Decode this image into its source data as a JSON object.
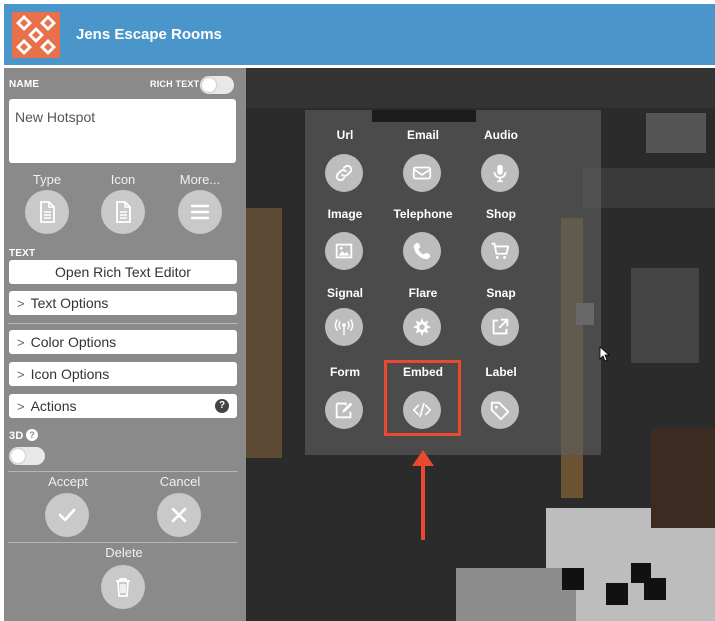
{
  "app": {
    "title": "Jens Escape Rooms"
  },
  "sidebar": {
    "name_label": "NAME",
    "rich_text_label": "RICH TEXT",
    "name_value": "New Hotspot",
    "type_label": "Type",
    "icon_label": "Icon",
    "more_label": "More...",
    "text_label": "TEXT",
    "rich_editor_button": "Open Rich Text Editor",
    "text_options": "Text Options",
    "color_options": "Color Options",
    "icon_options": "Icon Options",
    "actions": "Actions",
    "actions_help": "?",
    "threed_label": "3D",
    "threed_help": "?",
    "accept_label": "Accept",
    "cancel_label": "Cancel",
    "delete_label": "Delete"
  },
  "icon_picker": {
    "items": [
      {
        "label": "Url",
        "icon": "link-icon"
      },
      {
        "label": "Email",
        "icon": "envelope-icon"
      },
      {
        "label": "Audio",
        "icon": "microphone-icon"
      },
      {
        "label": "Image",
        "icon": "image-icon"
      },
      {
        "label": "Telephone",
        "icon": "phone-icon"
      },
      {
        "label": "Shop",
        "icon": "cart-icon"
      },
      {
        "label": "Signal",
        "icon": "signal-icon"
      },
      {
        "label": "Flare",
        "icon": "flare-icon"
      },
      {
        "label": "Snap",
        "icon": "external-link-icon"
      },
      {
        "label": "Form",
        "icon": "form-edit-icon"
      },
      {
        "label": "Embed",
        "icon": "code-icon"
      },
      {
        "label": "Label",
        "icon": "tag-icon"
      }
    ],
    "highlighted": "Embed"
  },
  "colors": {
    "header": "#4a95c9",
    "sidebar": "#8a8a8a",
    "highlight": "#e8492f"
  }
}
